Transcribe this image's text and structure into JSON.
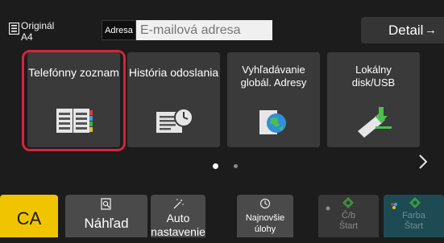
{
  "header": {
    "original_label": "Originál",
    "original_size": "A4",
    "address_label": "Adresa",
    "address_placeholder": "E-mailová adresa",
    "detail_label": "Detail",
    "detail_arrow": "→"
  },
  "tiles": [
    {
      "label": "Telefónny zoznam",
      "icon": "address-book-icon",
      "selected": true
    },
    {
      "label": "História odoslania",
      "icon": "send-history-icon",
      "selected": false
    },
    {
      "label_line1": "Vyhľadávanie",
      "label_line2": "globál. Adresy",
      "icon": "global-search-icon",
      "selected": false
    },
    {
      "label_line1": "Lokálny",
      "label_line2": "disk/USB",
      "icon": "usb-drive-icon",
      "selected": false
    }
  ],
  "pager": {
    "pages": 2,
    "current": 1,
    "next_icon": "chevron-right-icon"
  },
  "bottom_bar": {
    "ca_label": "CA",
    "preview_label": "Náhľad",
    "auto_label_line1": "Auto",
    "auto_label_line2": "nastavenie",
    "recent_label_line1": "Najnovšie",
    "recent_label_line2": "úlohy",
    "bw_start_line1": "Č/b",
    "bw_start_line2": "Štart",
    "color_start_line1": "Farba",
    "color_start_line2": "Štart"
  },
  "colors": {
    "background": "#1c1c1c",
    "tile": "#3a3a3a",
    "selection": "#d4263a",
    "ca_button": "#f1c400",
    "color_start": "#1e4b53",
    "start_icon_green": "#3fae3f"
  }
}
